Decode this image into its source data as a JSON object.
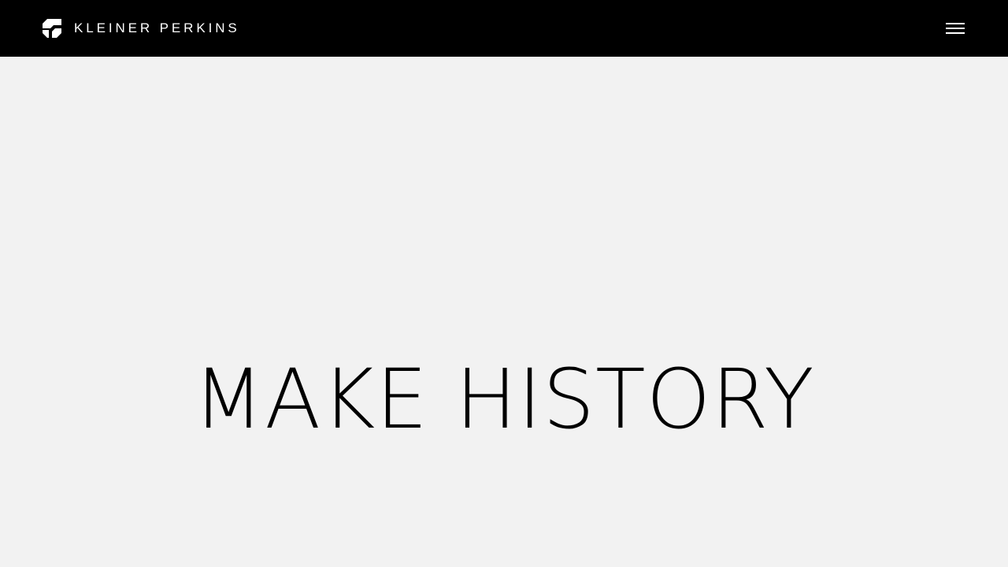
{
  "colors": {
    "header_background": "#000000",
    "page_background": "#f2f2f2",
    "header_foreground": "#ffffff",
    "hero_text": "#000000"
  },
  "header": {
    "logo": {
      "icon": "kleiner-perkins-logo-icon",
      "text": "KLEINER PERKINS"
    },
    "menu_button": {
      "icon": "hamburger-menu-icon"
    }
  },
  "hero": {
    "title": "MAKE HISTORY"
  }
}
